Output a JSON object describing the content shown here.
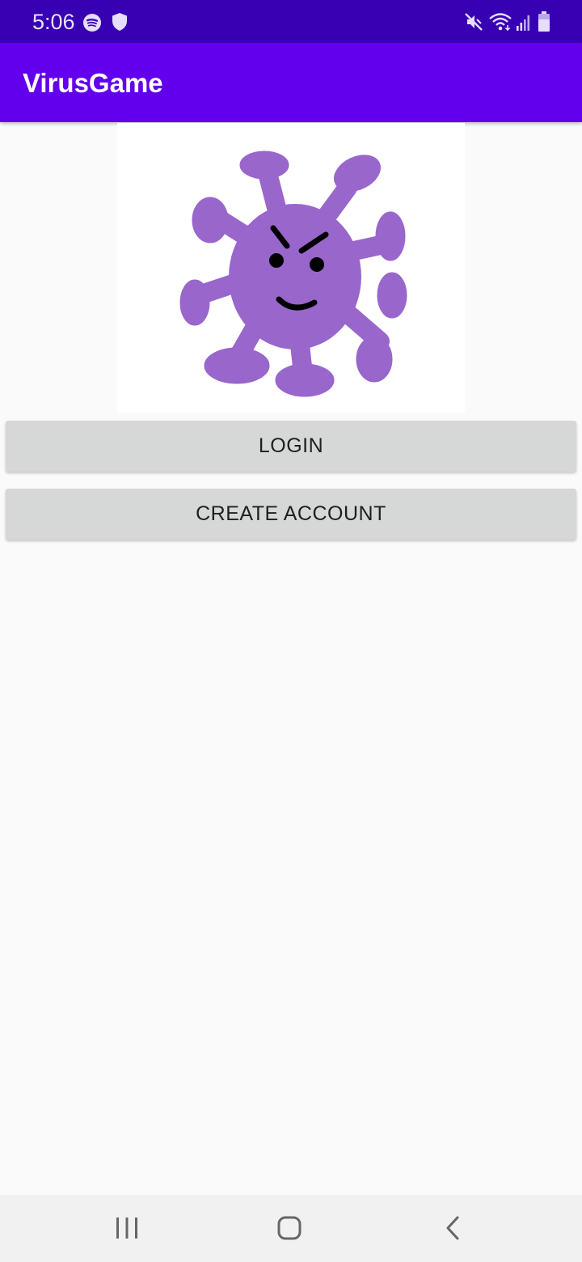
{
  "status_bar": {
    "time": "5:06",
    "left_icons": [
      "spotify-icon",
      "shield-icon"
    ],
    "right_icons": [
      "mute-icon",
      "wifi-icon",
      "signal-icon",
      "battery-icon"
    ],
    "background": "#3700b3"
  },
  "app_bar": {
    "title": "VirusGame",
    "background": "#6200ee"
  },
  "hero": {
    "icon": "virus-character-icon",
    "virus_color": "#9966cc"
  },
  "buttons": {
    "login_label": "LOGIN",
    "create_account_label": "CREATE ACCOUNT",
    "background": "#d6d7d7"
  },
  "nav_bar": {
    "icons": [
      "recent-apps-icon",
      "home-icon",
      "back-icon"
    ]
  }
}
